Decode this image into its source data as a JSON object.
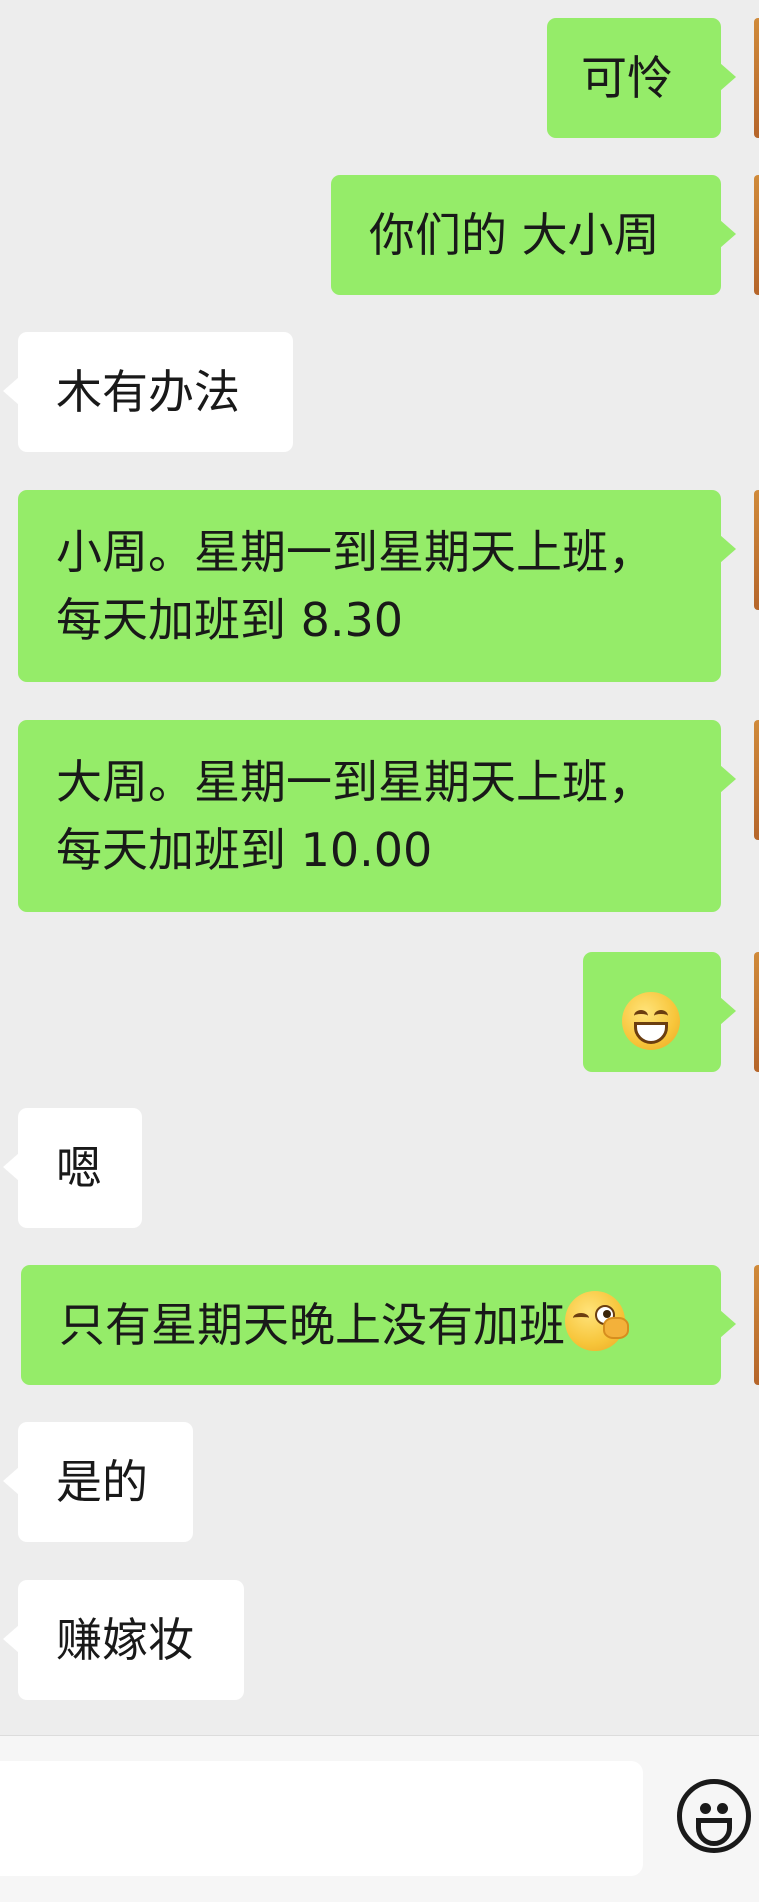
{
  "messages": [
    {
      "side": "out",
      "text": "可怜"
    },
    {
      "side": "out",
      "text": "你们的 大小周"
    },
    {
      "side": "in",
      "text": "木有办法"
    },
    {
      "side": "out",
      "line1": "小周。星期一到星期天上班，",
      "line2": "每天加班到 8.30"
    },
    {
      "side": "out",
      "line1": "大周。星期一到星期天上班，",
      "line2": "每天加班到 10.00"
    },
    {
      "side": "out",
      "emoji": "grinning-face-emoji"
    },
    {
      "side": "in",
      "text": "嗯"
    },
    {
      "side": "out",
      "text": "只有星期天晚上没有加班",
      "emoji": "wink-face-emoji"
    },
    {
      "side": "in",
      "text": "是的"
    },
    {
      "side": "in",
      "text": "赚嫁妆"
    }
  ],
  "input": {
    "value": "",
    "emoji_button_icon": "smiley-face-icon"
  },
  "colors": {
    "background": "#ededed",
    "outgoing_bubble": "#95ec69",
    "incoming_bubble": "#ffffff",
    "text": "#191919"
  }
}
